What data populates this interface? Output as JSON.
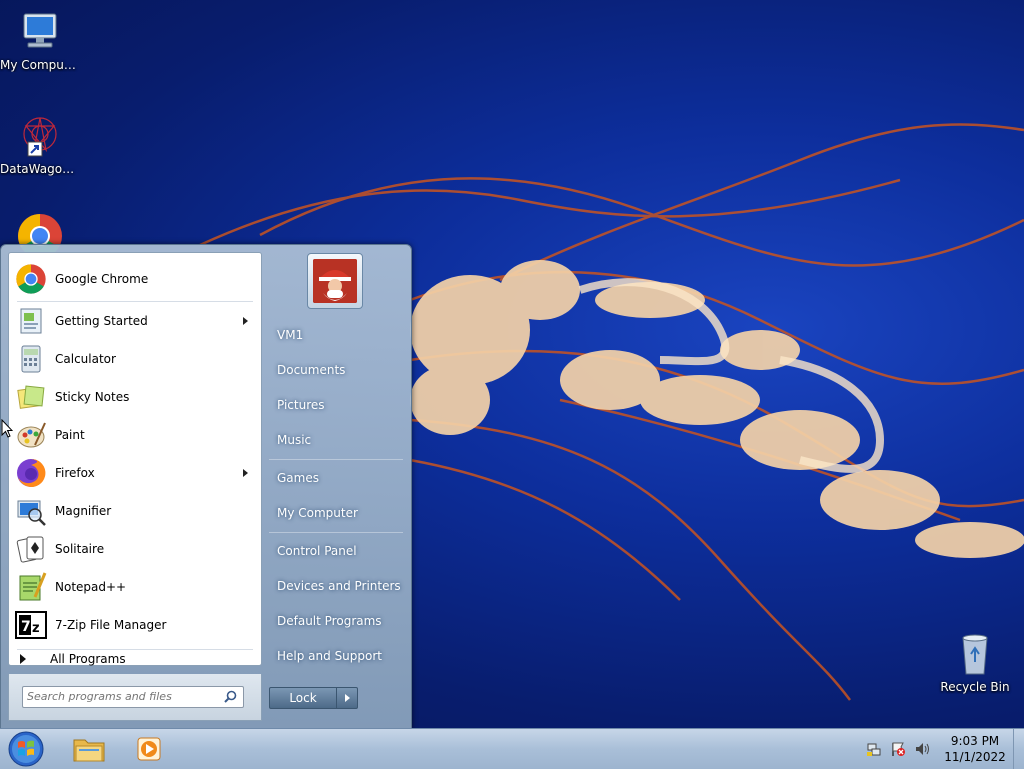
{
  "desktop": {
    "icons": [
      {
        "label": "My Computer"
      },
      {
        "label": "DataWagon..."
      },
      {
        "label": "Recycle Bin"
      }
    ]
  },
  "start_menu": {
    "programs": [
      {
        "label": "Google Chrome",
        "icon": "chrome-icon",
        "submenu": false
      },
      {
        "label": "Getting Started",
        "icon": "getting-started-icon",
        "submenu": true
      },
      {
        "label": "Calculator",
        "icon": "calculator-icon",
        "submenu": false
      },
      {
        "label": "Sticky Notes",
        "icon": "sticky-notes-icon",
        "submenu": false
      },
      {
        "label": "Paint",
        "icon": "paint-icon",
        "submenu": false
      },
      {
        "label": "Firefox",
        "icon": "firefox-icon",
        "submenu": true
      },
      {
        "label": "Magnifier",
        "icon": "magnifier-icon",
        "submenu": false
      },
      {
        "label": "Solitaire",
        "icon": "solitaire-icon",
        "submenu": false
      },
      {
        "label": "Notepad++",
        "icon": "notepadpp-icon",
        "submenu": false
      },
      {
        "label": "7-Zip File Manager",
        "icon": "7zip-icon",
        "submenu": false
      }
    ],
    "all_programs": "All Programs",
    "search_placeholder": "Search programs and files",
    "right_items": [
      {
        "label": "VM1"
      },
      {
        "label": "Documents"
      },
      {
        "label": "Pictures"
      },
      {
        "label": "Music"
      },
      {
        "label": "Games"
      },
      {
        "label": "My Computer"
      },
      {
        "label": "Control Panel"
      },
      {
        "label": "Devices and Printers"
      },
      {
        "label": "Default Programs"
      },
      {
        "label": "Help and Support"
      }
    ],
    "lock_label": "Lock"
  },
  "taskbar": {
    "apps": [
      {
        "icon": "file-explorer-icon"
      },
      {
        "icon": "media-player-icon"
      }
    ],
    "clock_time": "9:03 PM",
    "clock_date": "11/1/2022"
  },
  "colors": {
    "desktop_blue": "#0d2e9c",
    "jellyfish_orange": "#d9602a"
  }
}
